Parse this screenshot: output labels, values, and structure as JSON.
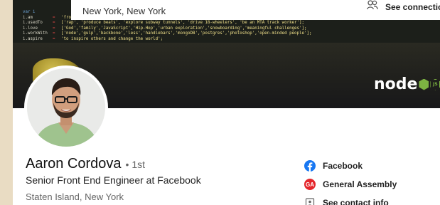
{
  "banner": {
    "code_lines": [
      {
        "key": "var i",
        "op": "",
        "value": ""
      },
      {
        "key": "i.am",
        "op": "=",
        "value": "'front end developer';"
      },
      {
        "key": "i.usedTo",
        "op": "=",
        "value": "['rap', 'produce beats', 'explore subway tunnels', 'drive 18-wheelers', 'be an MTA track worker'];"
      },
      {
        "key": "i.love",
        "op": "=",
        "value": "['God','family','JavaScript','Hip-Hop','urban exploration','snowboarding','meaningful challenges'];"
      },
      {
        "key": "i.workWith",
        "op": "=",
        "value": "['node','gulp','backbone','less','handlebars','mongoDB','postgres','photoshop','open-minded people'];"
      },
      {
        "key": "i.aspire",
        "op": "=",
        "value": "'to inspire others and change the world';"
      }
    ],
    "logo_text": "node",
    "logo_badge": "JS"
  },
  "topbar": {
    "location": "New York, New York",
    "connections_label": "See connectio"
  },
  "profile": {
    "name": "Aaron Cordova",
    "degree": "• 1st",
    "headline": "Senior Front End Engineer at Facebook",
    "location": "Staten Island, New York"
  },
  "aside": {
    "items": [
      {
        "label": "Facebook",
        "icon": "facebook-icon",
        "color": "#1877f2"
      },
      {
        "label": "General Assembly",
        "icon": "general-assembly-icon",
        "color": "#e4252b"
      },
      {
        "label": "See contact info",
        "icon": "contact-card-icon",
        "color": "#666666"
      }
    ]
  },
  "colors": {
    "banner_bg": "#1c1f1a",
    "code_text": "#f0e08a",
    "node_green": "#7cb342"
  }
}
